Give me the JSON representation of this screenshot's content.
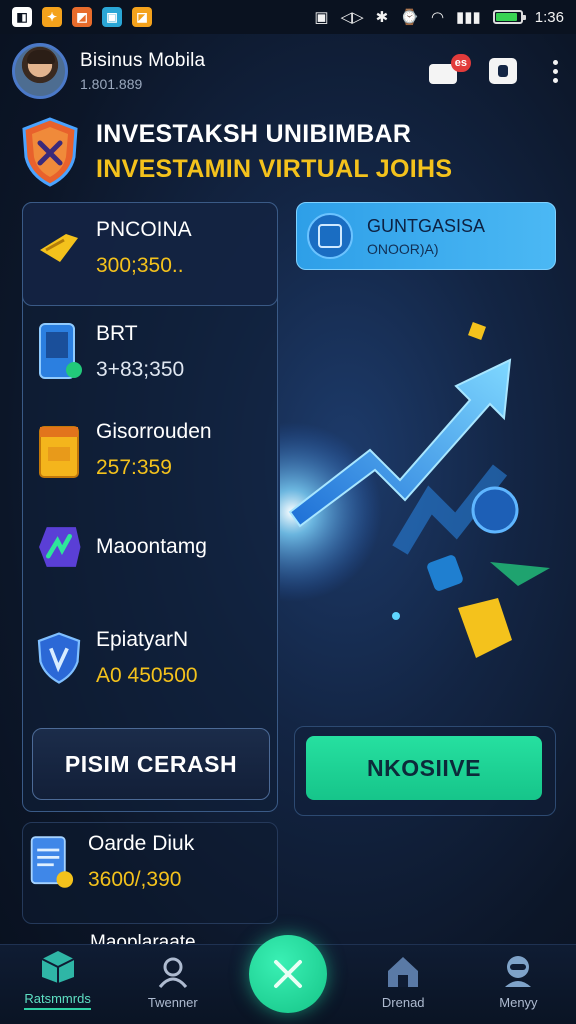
{
  "status_bar": {
    "time": "1:36",
    "apps": [
      {
        "icon": "app-icon",
        "color": "#ffffff"
      },
      {
        "icon": "app-icon",
        "color": "#f4a21c"
      },
      {
        "icon": "app-icon",
        "color": "#e86c2c"
      },
      {
        "icon": "app-icon",
        "color": "#2aa6d6"
      },
      {
        "icon": "app-icon",
        "color": "#f4a21c"
      }
    ]
  },
  "header": {
    "user_name": "Bisinus Mobila",
    "user_id": "1.801.889",
    "notification_badge": "es"
  },
  "hero": {
    "title": "INVESTAKSH UNIBIMBAR",
    "subtitle": "INVESTAMIN VIRTUAL JOIHS"
  },
  "assets": [
    {
      "name": "PNCOINA",
      "value": "300;350..",
      "icon": "rocket-coin-icon"
    },
    {
      "name": "BRT",
      "value": "3+83;350",
      "icon": "phone-wallet-icon"
    },
    {
      "name": "Gisorrouden",
      "value": "257:359",
      "icon": "calendar-icon"
    },
    {
      "name": "Maoontamg",
      "value": "",
      "icon": "chart-hex-icon"
    },
    {
      "name": "EpiatyarN",
      "value": "A0 450500",
      "icon": "shield-icon"
    }
  ],
  "promo": {
    "title": "GUNTGASISA",
    "subtitle": "ONOOR)A)"
  },
  "actions": {
    "left_label": "PISIM CERASH",
    "right_label": "NKOSIIVE"
  },
  "lower_asset": {
    "name": "Oarde Diuk",
    "value": "3600/,390"
  },
  "partial_asset": {
    "name": "Maoplaraate"
  },
  "bottom_nav": [
    {
      "label": "Ratsmmrds",
      "icon": "cube-icon",
      "active": true
    },
    {
      "label": "Twenner",
      "icon": "user-scan-icon",
      "active": false
    },
    {
      "label": "",
      "icon": "close-icon",
      "active": false
    },
    {
      "label": "Drenad",
      "icon": "home-icon",
      "active": false
    },
    {
      "label": "Menyy",
      "icon": "support-agent-icon",
      "active": false
    }
  ],
  "colors": {
    "accent_yellow": "#f4c21c",
    "accent_green": "#1fd399",
    "accent_blue": "#3aa9ee"
  }
}
